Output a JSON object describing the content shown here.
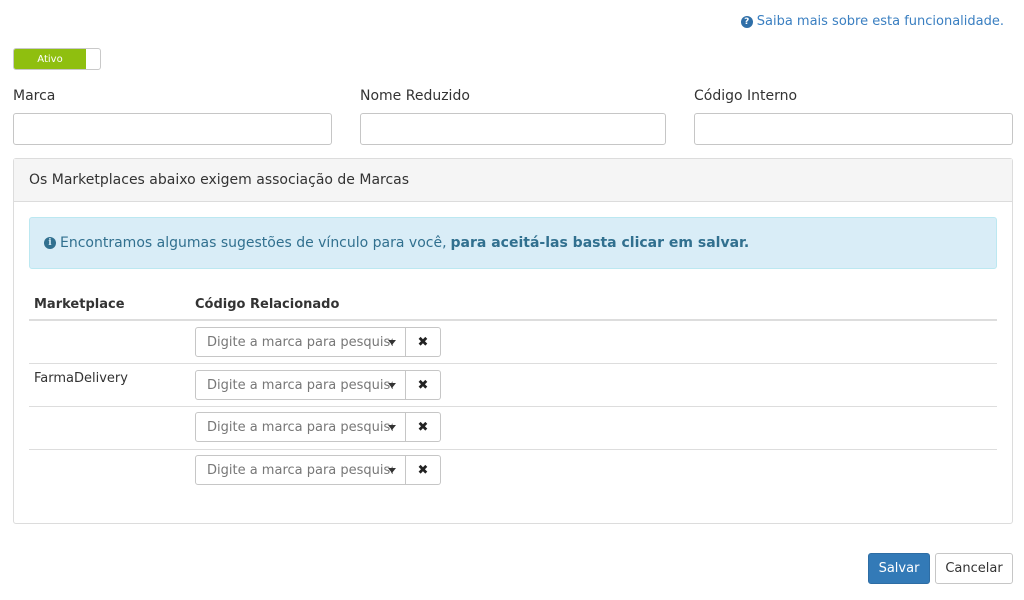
{
  "help": {
    "icon": "question-circle-icon",
    "text": "Saiba mais sobre esta funcionalidade."
  },
  "toggle": {
    "label": "Ativo",
    "state": "on",
    "color": "#8fbf0f"
  },
  "fields": {
    "marca": {
      "label": "Marca",
      "value": ""
    },
    "nome_reduzido": {
      "label": "Nome Reduzido",
      "value": ""
    },
    "codigo_interno": {
      "label": "Código Interno",
      "value": ""
    }
  },
  "panel": {
    "heading": "Os Marketplaces abaixo exigem associação de Marcas",
    "alert": {
      "icon": "info-circle-icon",
      "text": "Encontramos algumas sugestões de vínculo para você,",
      "strong": "para aceitá-las basta clicar em salvar."
    },
    "table": {
      "headers": [
        "Marketplace",
        "Código Relacionado"
      ],
      "rows": [
        {
          "marketplace": "",
          "placeholder": "Digite a marca para pesquisar"
        },
        {
          "marketplace": "FarmaDelivery",
          "placeholder": "Digite a marca para pesquisar"
        },
        {
          "marketplace": "",
          "placeholder": "Digite a marca para pesquisar"
        },
        {
          "marketplace": "",
          "placeholder": "Digite a marca para pesquisar"
        }
      ],
      "clear_icon": "times-icon",
      "clear_glyph": "✖"
    }
  },
  "buttons": {
    "save": "Salvar",
    "cancel": "Cancelar"
  },
  "colors": {
    "primary": "#337ab7",
    "link": "#3a7fc1",
    "alert_bg": "#d9edf7",
    "alert_text": "#31708f"
  }
}
